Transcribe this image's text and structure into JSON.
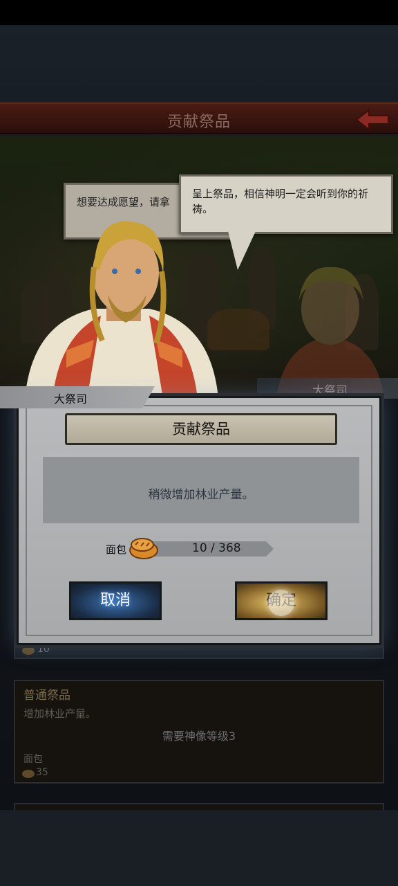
{
  "header": {
    "title": "贡献祭品"
  },
  "speech": {
    "back_text": "想要达成愿望，请拿",
    "front_text": "呈上祭品，相信神明一定会听到你的祈祷。"
  },
  "characters": {
    "name": "大祭司",
    "ghost_name": "大祭司"
  },
  "dialog": {
    "title": "贡献祭品",
    "description": "稍微增加林业产量。",
    "cost_label": "面包",
    "cost_value": "10 / 368",
    "cancel_label": "取消",
    "confirm_label": "确定"
  },
  "list": {
    "card_a": {
      "count": "10"
    },
    "card_b": {
      "title": "普通祭品",
      "description": "增加林业产量。",
      "requirement": "需要神像等级3",
      "resource": "面包",
      "count": "35"
    }
  }
}
